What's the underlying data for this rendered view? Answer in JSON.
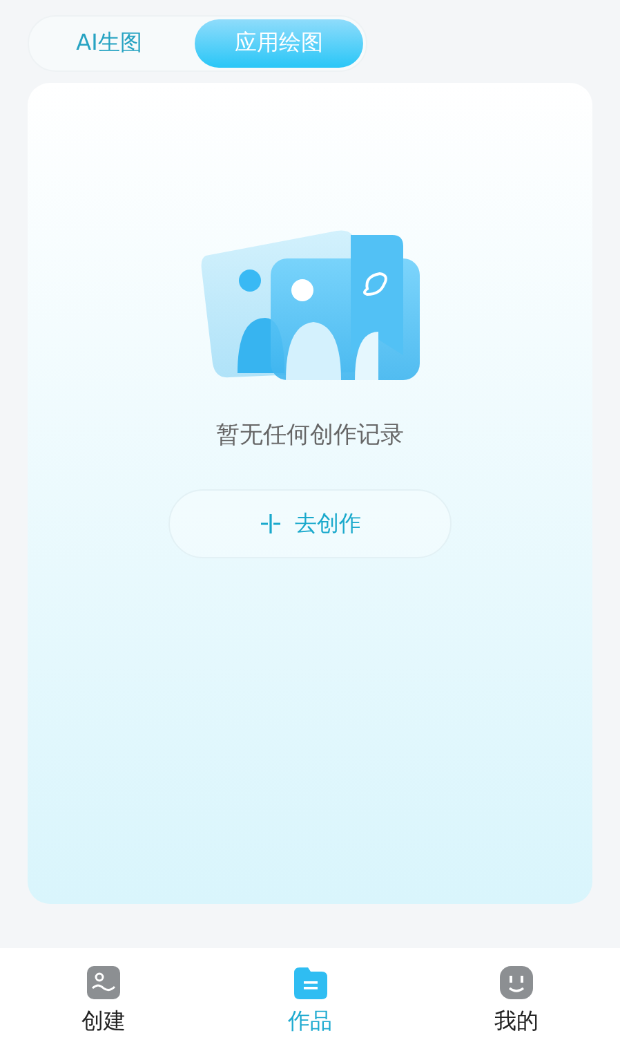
{
  "top_tabs": [
    {
      "label": "AI生图",
      "selected": false
    },
    {
      "label": "应用绘图",
      "selected": true
    }
  ],
  "empty_state": {
    "message": "暂无任何创作记录",
    "action": "去创作"
  },
  "bottom_nav": [
    {
      "label": "创建",
      "kind": "picture",
      "selected": false
    },
    {
      "label": "作品",
      "kind": "folder",
      "selected": true
    },
    {
      "label": "我的",
      "kind": "face",
      "selected": false
    }
  ]
}
